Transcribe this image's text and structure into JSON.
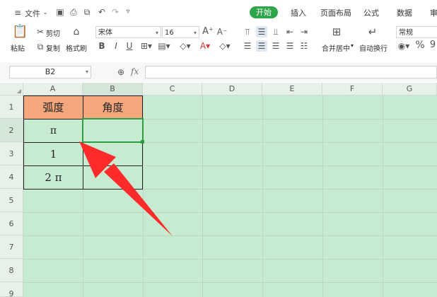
{
  "topbar": {
    "file_menu": "文件",
    "tabs": [
      "开始",
      "插入",
      "页面布局",
      "公式",
      "数据",
      "审"
    ]
  },
  "ribbon": {
    "paste": "粘贴",
    "cut": "剪切",
    "copy": "复制",
    "format_painter": "格式刷",
    "font_name": "宋体",
    "font_size": "16",
    "grow_font": "A⁺",
    "shrink_font": "A⁻",
    "bold": "B",
    "italic": "I",
    "underline": "U",
    "merge_center": "合并居中",
    "wrap_text": "自动换行",
    "number_format": "常规",
    "percent": "%",
    "thousands": "9"
  },
  "formula_bar": {
    "name_box": "B2",
    "fx": "fx",
    "formula": ""
  },
  "columns": [
    "A",
    "B",
    "C",
    "D",
    "E",
    "F",
    "G"
  ],
  "rows": [
    "1",
    "2",
    "3",
    "4",
    "5",
    "6",
    "7",
    "8",
    "9"
  ],
  "table": {
    "header": [
      "弧度",
      "角度"
    ],
    "rows": [
      [
        "π",
        ""
      ],
      [
        "1",
        ""
      ],
      [
        "2 π",
        ""
      ]
    ]
  },
  "colors": {
    "sheet_bg": "#c7ebd0",
    "header_fill": "#f4a67c",
    "selection": "#2e9e45",
    "arrow": "#ff2a2a",
    "active_tab": "#2ea64a"
  }
}
